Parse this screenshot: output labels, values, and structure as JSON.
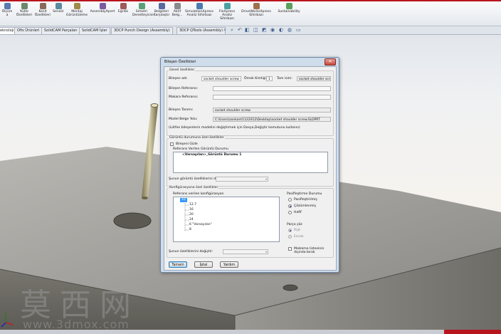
{
  "ribbon": {
    "items": [
      {
        "label": "Ölçüm",
        "label2": "a",
        "icon": "ruler-icon"
      },
      {
        "label": "Kütle",
        "label2": "Özellikleri",
        "icon": "mass-icon"
      },
      {
        "label": "Kesit",
        "label2": "Özellikleri",
        "icon": "section-icon"
      },
      {
        "label": "Sensör",
        "label2": "",
        "icon": "sensor-icon"
      },
      {
        "label": "Montaj",
        "label2": "Görüntüleme",
        "icon": "assembly-view-icon"
      },
      {
        "label": "AssemblyXpert",
        "label2": "",
        "icon": "assemblyxpert-icon"
      },
      {
        "label": "Eğrilik",
        "label2": "",
        "icon": "curvature-icon"
      },
      {
        "label": "Simetri",
        "label2": "Denetleyicisi",
        "icon": "symmetry-icon"
      },
      {
        "label": "Belgeleri",
        "label2": "Karşılaştır",
        "icon": "compare-icon"
      },
      {
        "label": "Aktif",
        "label2": "Belg...",
        "icon": "active-doc-icon"
      },
      {
        "label": "SimulationXpress",
        "label2": "Analiz Sihirbazı",
        "icon": "simulationxpress-icon"
      },
      {
        "label": "FloXpress",
        "label2": "Analiz Sihirbazı",
        "icon": "floxpress-icon"
      },
      {
        "label": "DriveWorksXpress",
        "label2": "Sihirbazı",
        "icon": "driveworksxpress-icon"
      },
      {
        "label": "Sustainability",
        "label2": "",
        "icon": "sustainability-icon"
      }
    ]
  },
  "tabs": [
    "eknoloji",
    "Ofis Ürünleri",
    "SolidCAM Parçaları",
    "SolidCAM İşler",
    "3DCP Punch Design (Assembly)",
    "3DCP QTools (Assembly)"
  ],
  "dialog": {
    "title": "Bileşen Özellikleri",
    "close": "✕",
    "general": {
      "title": "Genel özellikler",
      "name_label": "Bileşen adı:",
      "name_value": "socket shoulder screw",
      "instance_label": "Örnek Kimliği:",
      "instance_value": "1",
      "fullname_label": "Tam isim:",
      "fullname_value": "socket shoulder scre",
      "ref_label": "Bileşen Referansı:",
      "ref_value": "",
      "reel_label": "Makara Referansı:",
      "reel_value": "",
      "desc_label": "Bileşen Tanımı:",
      "desc_value": "socket shoulder screw",
      "path_label": "Model Belge Yolu:",
      "path_value": "C:\\Users\\zonkant1122012\\Desktop\\socket shoulder screw.SLDPRT",
      "note": "(Lütfen bileşenlerin modelini değiştirmek için Dosya,Değiştir komutunu kullanın)"
    },
    "display": {
      "title": "Görüntü durumuna özel özellikler",
      "hide_label": "Bileşeni Gizle",
      "ref_list_label": "Referans Verilen Görüntü Durumu",
      "ref_list_item": "<Varsayılan>_Görüntü Durumu 1",
      "change_label": "Şunun görüntü özelliklerini değiştir:"
    },
    "config": {
      "title": "Konfigürasyona özel özellikler",
      "ref_label": "Referans verilen konfigürasyon",
      "items": [
        "10",
        "12.7",
        "16",
        "20",
        "24",
        "6 \"Varsayılan\"",
        "8"
      ],
      "selected": "10",
      "suppress_title": "Pasifleştirme Durumu",
      "suppress_options": [
        "Pasifleştirilmiş",
        "Çözümlenmiş",
        "Hafif"
      ],
      "suppress_selected": "Çözümlenmiş",
      "solve_title": "Parça çöz",
      "solve_options": [
        "Rijit",
        "Esnek"
      ],
      "exclude_label": "Malzeme listesinin dışında bırak",
      "change_label": "Şunun özelliklerini değiştir:"
    },
    "buttons": {
      "ok": "Tamam",
      "cancel": "İptal",
      "help": "Yardım"
    }
  },
  "watermark": {
    "logo": "莫西网",
    "url": "www.3dmox.com"
  }
}
